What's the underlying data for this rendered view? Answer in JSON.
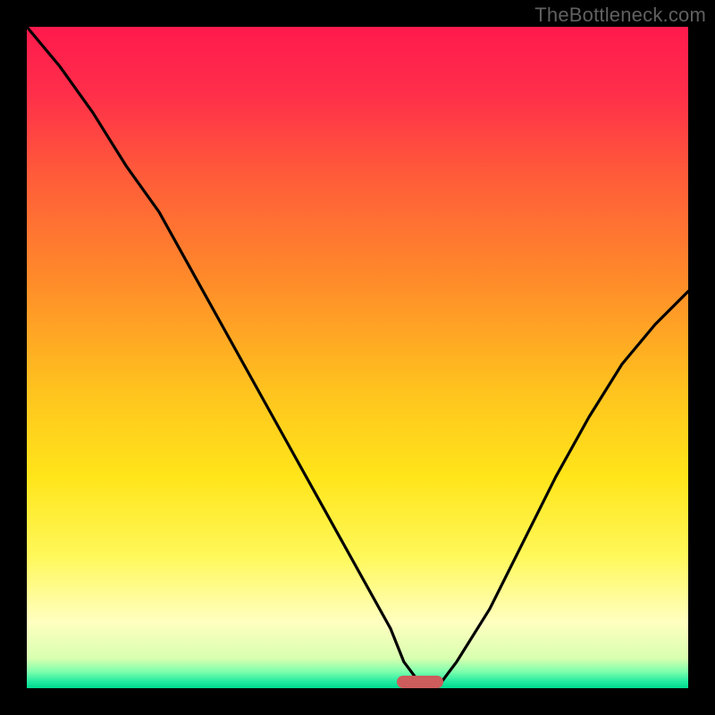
{
  "watermark": {
    "text": "TheBottleneck.com"
  },
  "colors": {
    "gradient_stops": [
      {
        "stop": 0.0,
        "color": "#ff1a4d"
      },
      {
        "stop": 0.1,
        "color": "#ff2e4a"
      },
      {
        "stop": 0.22,
        "color": "#ff5a3a"
      },
      {
        "stop": 0.38,
        "color": "#ff8a2a"
      },
      {
        "stop": 0.55,
        "color": "#ffc31e"
      },
      {
        "stop": 0.68,
        "color": "#ffe51a"
      },
      {
        "stop": 0.8,
        "color": "#fff85a"
      },
      {
        "stop": 0.9,
        "color": "#ffffc0"
      },
      {
        "stop": 0.955,
        "color": "#d8ffb0"
      },
      {
        "stop": 0.975,
        "color": "#7dffad"
      },
      {
        "stop": 0.99,
        "color": "#22eaa0"
      },
      {
        "stop": 1.0,
        "color": "#00d88f"
      }
    ],
    "curve": "#000000",
    "marker": "#cd5c5c",
    "frame": "#000000"
  },
  "chart_data": {
    "type": "line",
    "title": "",
    "xlabel": "",
    "ylabel": "",
    "xlim": [
      0,
      100
    ],
    "ylim": [
      0,
      100
    ],
    "grid": false,
    "legend": false,
    "series": [
      {
        "name": "bottleneck-curve",
        "x": [
          0,
          5,
          10,
          15,
          20,
          25,
          30,
          35,
          40,
          45,
          50,
          55,
          57,
          60,
          62,
          65,
          70,
          75,
          80,
          85,
          90,
          95,
          100
        ],
        "values": [
          100,
          94,
          87,
          79,
          72,
          63,
          54,
          45,
          36,
          27,
          18,
          9,
          4,
          0,
          0,
          4,
          12,
          22,
          32,
          41,
          49,
          55,
          60
        ]
      }
    ],
    "annotations": [
      {
        "name": "optimal-marker",
        "x_start": 56,
        "x_end": 63,
        "y": 0,
        "color": "#cd5c5c"
      }
    ]
  }
}
